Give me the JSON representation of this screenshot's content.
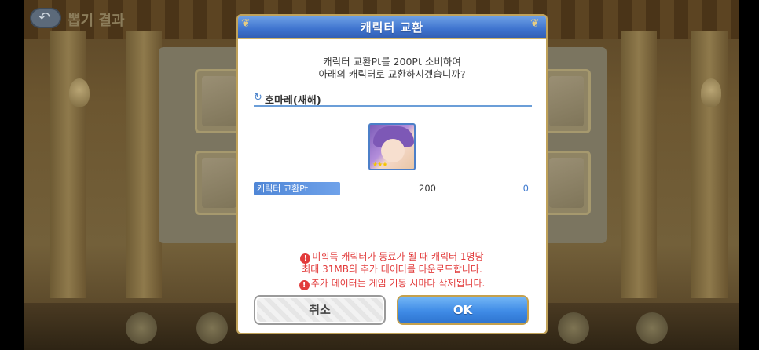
{
  "background": {
    "title": "뽑기 결과"
  },
  "dialog": {
    "title": "캐릭터 교환",
    "message_line1": "캐릭터 교환Pt를 200Pt 소비하여",
    "message_line2": "아래의 캐릭터로 교환하시겠습니까?",
    "character_name": "호마레(새해)",
    "character_stars": "★★★",
    "points": {
      "label": "캐릭터 교환Pt",
      "cost": "200",
      "remaining": "0"
    },
    "warnings": {
      "line1": "미획득 캐릭터가 동료가 될 때 캐릭터 1명당",
      "line2": "최대 31MB의 추가 데이터를 다운로드합니다.",
      "line3": "추가 데이터는 게임 기동 시마다 삭제됩니다."
    },
    "buttons": {
      "cancel": "취소",
      "ok": "OK"
    }
  },
  "colors": {
    "header_blue": "#3f74cf",
    "warning_red": "#e23b3b",
    "ok_blue": "#3f8be6",
    "gold_border": "#c5a14d"
  }
}
